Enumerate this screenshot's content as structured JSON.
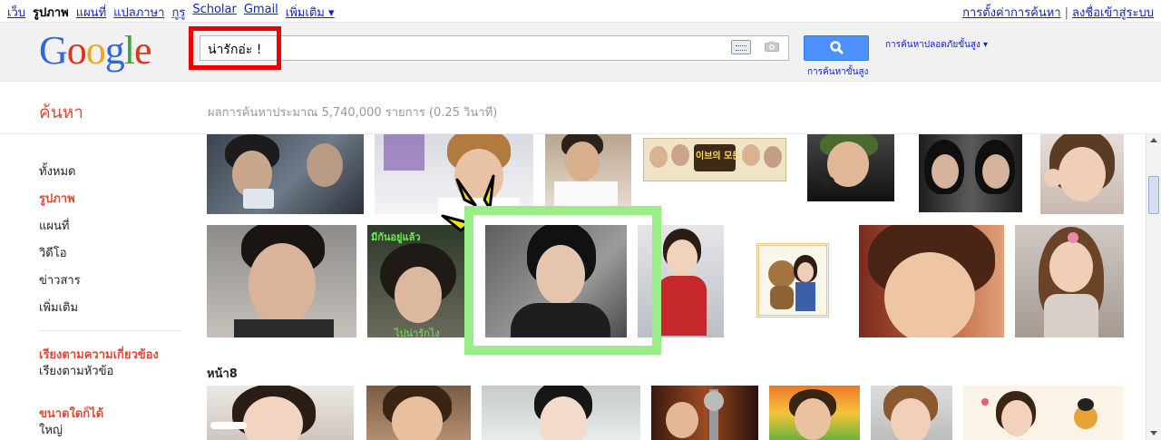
{
  "topnav": {
    "items": [
      "เว็บ",
      "รูปภาพ",
      "แผนที่",
      "แปลภาษา",
      "กูรู",
      "Scholar",
      "Gmail",
      "เพิ่มเติม ▾"
    ],
    "active_index": 1
  },
  "topright": {
    "settings": "การตั้งค่าการค้นหา",
    "separator": "|",
    "signin": "ลงชื่อเข้าสู่ระบบ"
  },
  "logo": {
    "letters": [
      "G",
      "o",
      "o",
      "g",
      "l",
      "e"
    ]
  },
  "search": {
    "query": "น่ารักอ่ะ !",
    "advanced_label": "การค้นหาขั้นสูง",
    "safesearch_label": "การค้นหาปลอดภัยขั้นสูง ▾"
  },
  "subheader": {
    "title": "ค้นหา",
    "stats": "ผลการค้นหาประมาณ 5,740,000 รายการ (0.25 วินาที)"
  },
  "sidebar": {
    "types": [
      "ทั้งหมด",
      "รูปภาพ",
      "แผนที่",
      "วิดีโอ",
      "ข่าวสาร",
      "เพิ่มเติม"
    ],
    "active_type_index": 1,
    "sort_active": "เรียงตามความเกี่ยวข้อง",
    "sort_other": "เรียงตามหัวข้อ",
    "size_heading": "ขนาดใดก็ได้",
    "size_option": "ใหญ่"
  },
  "results": {
    "page_label": "หน้า8",
    "thumb_labels": {
      "banner": "이브의 모든 것",
      "green_text": "มีกันอยู่แล้ว",
      "bottom_caption": "ไปน่ารักไง"
    }
  },
  "colors": {
    "highlight_red": "#ee0000",
    "highlight_green": "#99ee88",
    "accent_red": "#dd4b39",
    "link_blue": "#1122cc",
    "button_blue": "#4d90fe"
  }
}
